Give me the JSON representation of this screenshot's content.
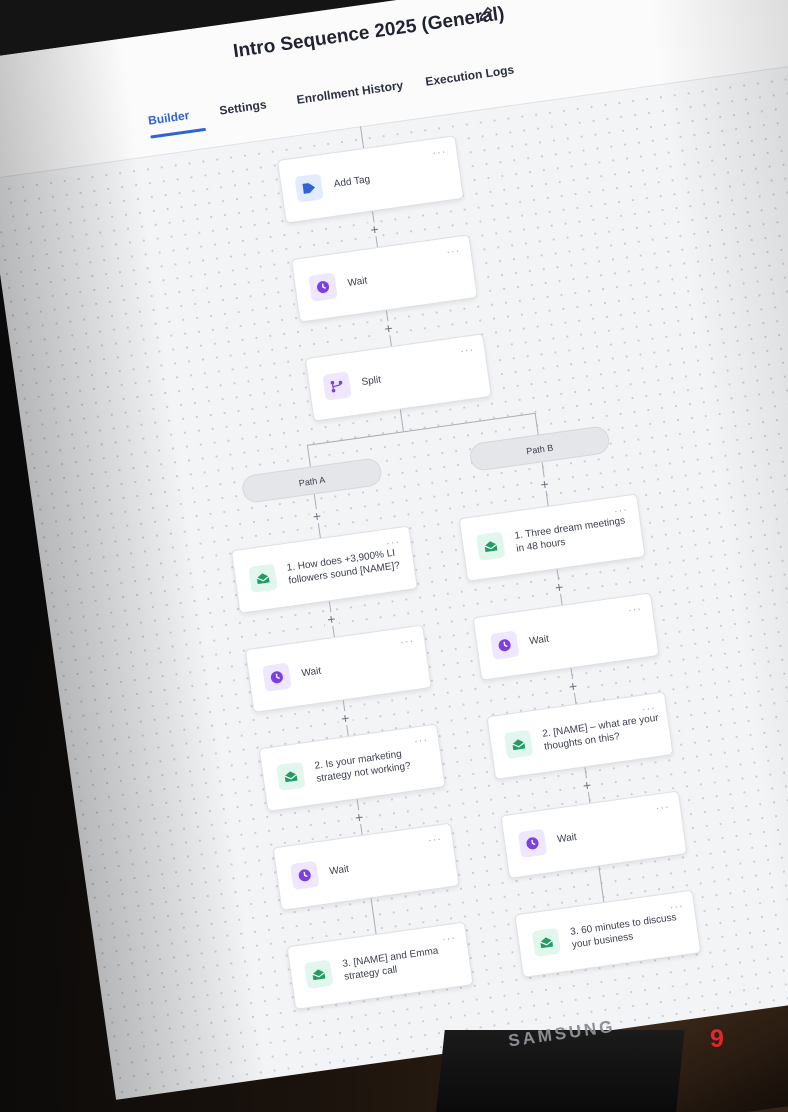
{
  "header": {
    "title": "Intro Sequence 2025 (General)",
    "tabs": [
      {
        "label": "Builder",
        "active": true
      },
      {
        "label": "Settings",
        "active": false
      },
      {
        "label": "Enrollment History",
        "active": false
      },
      {
        "label": "Execution Logs",
        "active": false
      }
    ]
  },
  "workflow": {
    "trunk": [
      {
        "label": "Add Tag",
        "icon": "tag-icon"
      },
      {
        "label": "Wait",
        "icon": "clock-icon"
      },
      {
        "label": "Split",
        "icon": "branch-icon"
      }
    ],
    "path_a": {
      "label": "Path A",
      "steps": [
        {
          "label": "1. How does +3,900% LI followers sound [NAME]?",
          "icon": "email-icon"
        },
        {
          "label": "Wait",
          "icon": "clock-icon"
        },
        {
          "label": "2. Is your marketing strategy not working?",
          "icon": "email-icon"
        },
        {
          "label": "Wait",
          "icon": "clock-icon"
        },
        {
          "label": "3. [NAME] and Emma strategy call",
          "icon": "email-icon"
        }
      ]
    },
    "path_b": {
      "label": "Path B",
      "steps": [
        {
          "label": "1. Three dream meetings in 48 hours",
          "icon": "email-icon"
        },
        {
          "label": "Wait",
          "icon": "clock-icon"
        },
        {
          "label": "2. [NAME] – what are your thoughts on this?",
          "icon": "email-icon"
        },
        {
          "label": "Wait",
          "icon": "clock-icon"
        },
        {
          "label": "3. 60 minutes to discuss your business",
          "icon": "email-icon"
        }
      ]
    },
    "more_glyph": "···",
    "plus_glyph": "+"
  },
  "monitor": {
    "brand": "SAMSUNG"
  },
  "page_number": "9",
  "colors": {
    "accent": "#2f63d6",
    "tag": "#2f63d6",
    "wait": "#7b3fe4",
    "email": "#1f9d63",
    "page_number": "#e5262b"
  }
}
